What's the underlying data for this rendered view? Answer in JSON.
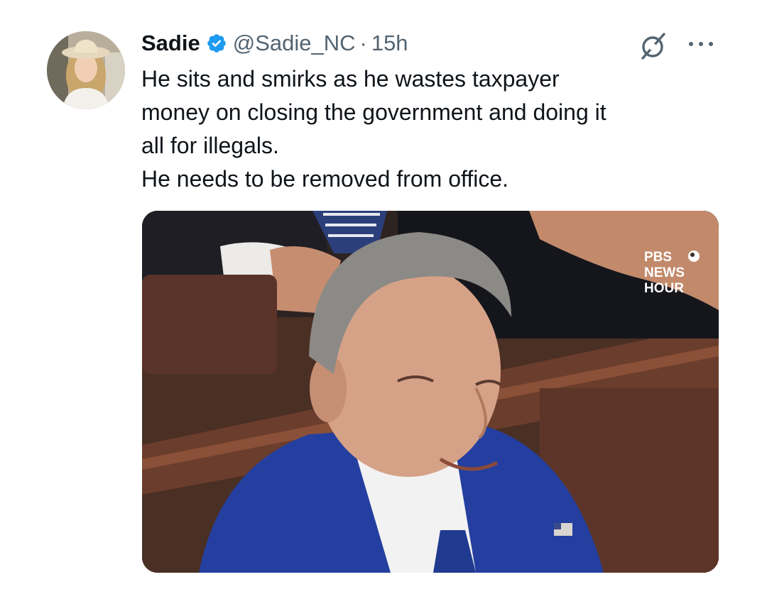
{
  "tweet": {
    "display_name": "Sadie",
    "handle": "@Sadie_NC",
    "separator": "·",
    "timestamp": "15h",
    "verified": true,
    "text_lines": [
      "He sits and smirks as he wastes taxpayer",
      "money on closing the government and doing it",
      "all for illegals.",
      "He needs to be removed from office."
    ],
    "media": {
      "watermark_lines": [
        "PBS",
        "NEWS",
        "HOUR"
      ]
    }
  },
  "icons": {
    "verified": "verified-badge-icon",
    "grok": "grok-icon",
    "more": "more-options-icon"
  },
  "colors": {
    "text": "#0f1419",
    "secondary": "#536471",
    "verified_blue": "#1d9bf0"
  }
}
